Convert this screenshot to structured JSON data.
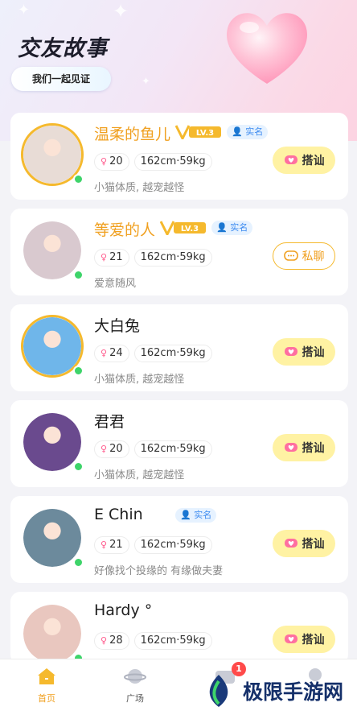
{
  "hero": {
    "title": "交友故事",
    "subtitle": "我们一起见证"
  },
  "users": [
    {
      "name": "温柔的鱼儿",
      "vip": true,
      "vip_label": "LV.3",
      "verified": true,
      "verified_label": "实名",
      "age": "20",
      "body": "162cm·59kg",
      "motto": "小猫体质, 越宠越怪",
      "action": "搭讪",
      "action_type": "chat",
      "avatar_color": "#e8dcd6"
    },
    {
      "name": "等爱的人",
      "vip": true,
      "vip_label": "LV.3",
      "verified": true,
      "verified_label": "实名",
      "age": "21",
      "body": "162cm·59kg",
      "motto": "爱意随风",
      "action": "私聊",
      "action_type": "msg",
      "avatar_color": "#d9c9cf"
    },
    {
      "name": "大白兔",
      "vip": false,
      "verified": false,
      "age": "24",
      "body": "162cm·59kg",
      "motto": "小猫体质, 越宠越怪",
      "action": "搭讪",
      "action_type": "chat",
      "avatar_color": "#6fb6ea"
    },
    {
      "name": "君君",
      "vip": false,
      "verified": false,
      "age": "20",
      "body": "162cm·59kg",
      "motto": "小猫体质, 越宠越怪",
      "action": "搭讪",
      "action_type": "chat",
      "avatar_color": "#6a4a8e"
    },
    {
      "name": "E Chin",
      "vip": false,
      "verified": true,
      "verified_label": "实名",
      "age": "21",
      "body": "162cm·59kg",
      "motto": "好像找个投缘的 有缘做夫妻",
      "action": "搭讪",
      "action_type": "chat",
      "avatar_color": "#6c8a9c"
    },
    {
      "name": "Hardy °",
      "vip": false,
      "verified": false,
      "age": "28",
      "body": "162cm·59kg",
      "motto": "",
      "action": "搭讪",
      "action_type": "chat",
      "avatar_color": "#e9c7bf"
    }
  ],
  "tabbar": {
    "home": "首页",
    "plaza": "广场",
    "message_badge": "1"
  },
  "watermark": {
    "text": "极限手游网"
  },
  "colors": {
    "accent": "#f0a020",
    "online": "#3ed46a",
    "chat_button": "#fff2a3"
  }
}
